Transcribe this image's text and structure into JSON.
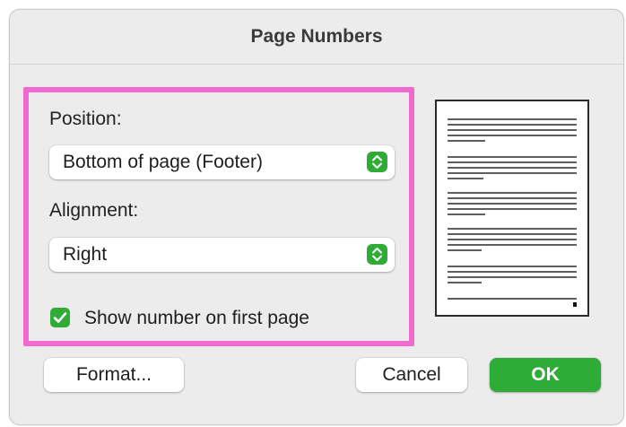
{
  "dialog": {
    "title": "Page Numbers"
  },
  "position": {
    "label": "Position:",
    "selected": "Bottom of page (Footer)"
  },
  "alignment": {
    "label": "Alignment:",
    "selected": "Right"
  },
  "show_first_page": {
    "label": "Show number on first page",
    "checked": true
  },
  "buttons": {
    "format": "Format...",
    "cancel": "Cancel",
    "ok": "OK"
  },
  "colors": {
    "accent": "#2fab37",
    "highlight": "#f06ad0"
  },
  "icons": {
    "stepper": "up-down-chevron-icon",
    "checkbox": "checkmark-icon"
  }
}
